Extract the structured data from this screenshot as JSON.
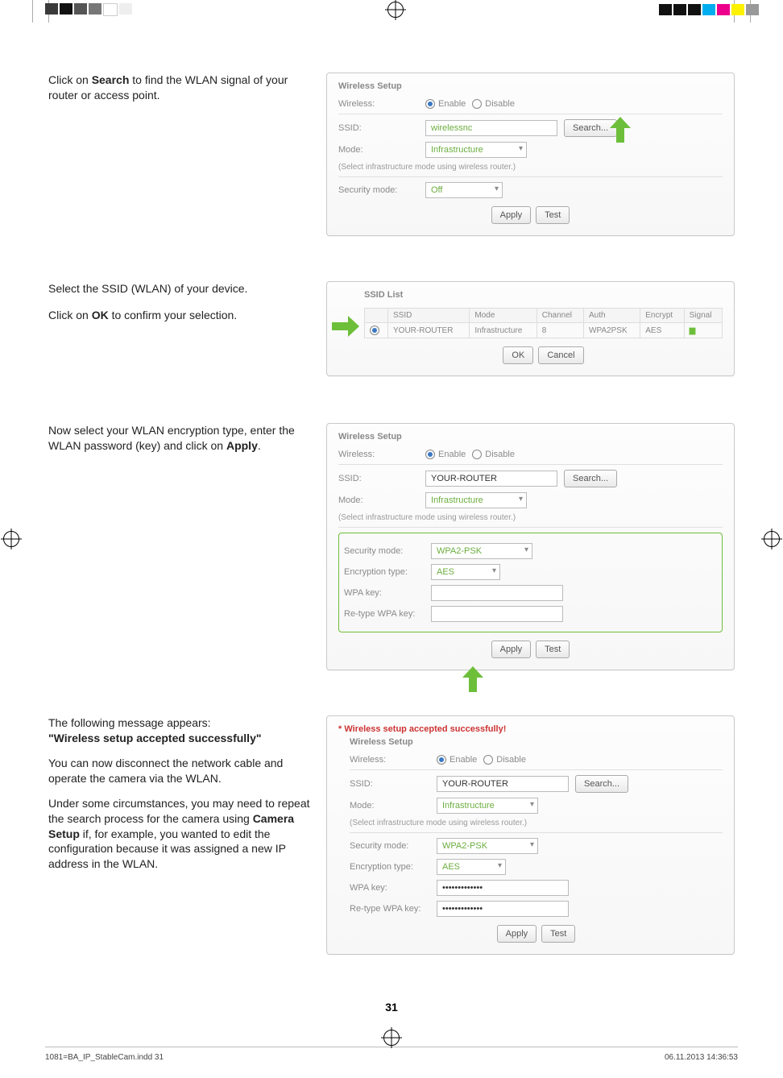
{
  "page_number": "31",
  "footer": {
    "file": "1081=BA_IP_StableCam.indd   31",
    "date": "06.11.2013   14:36:53"
  },
  "step1": {
    "text_pre": "Click on ",
    "bold1": "Search",
    "text_post": " to find the WLAN signal of your router or access point.",
    "panel_title": "Wireless Setup",
    "wireless_label": "Wireless:",
    "enable": "Enable",
    "disable": "Disable",
    "ssid_label": "SSID:",
    "ssid_value": "wirelessnc",
    "search_btn": "Search...",
    "mode_label": "Mode:",
    "mode_value": "Infrastructure",
    "mode_hint": "(Select infrastructure mode using wireless router.)",
    "sec_label": "Security mode:",
    "sec_value": "Off",
    "apply_btn": "Apply",
    "test_btn": "Test"
  },
  "step2": {
    "line1": "Select the SSID (WLAN) of your device.",
    "line2_pre": "Click on ",
    "line2_bold": "OK",
    "line2_post": " to confirm your selection.",
    "panel_title": "SSID List",
    "th_ssid": "SSID",
    "th_mode": "Mode",
    "th_channel": "Channel",
    "th_auth": "Auth",
    "th_encrypt": "Encrypt",
    "th_signal": "Signal",
    "row_ssid": "YOUR-ROUTER",
    "row_mode": "Infrastructure",
    "row_channel": "8",
    "row_auth": "WPA2PSK",
    "row_encrypt": "AES",
    "ok_btn": "OK",
    "cancel_btn": "Cancel"
  },
  "step3": {
    "text_pre": "Now select your WLAN encryption type, enter the WLAN password (key) and click on ",
    "bold": "Apply",
    "text_post": ".",
    "panel_title": "Wireless Setup",
    "wireless_label": "Wireless:",
    "enable": "Enable",
    "disable": "Disable",
    "ssid_label": "SSID:",
    "ssid_value": "YOUR-ROUTER",
    "search_btn": "Search...",
    "mode_label": "Mode:",
    "mode_value": "Infrastructure",
    "mode_hint": "(Select infrastructure mode using wireless router.)",
    "sec_label": "Security mode:",
    "sec_value": "WPA2-PSK",
    "enc_label": "Encryption type:",
    "enc_value": "AES",
    "wpa_label": "WPA key:",
    "rewpa_label": "Re-type WPA key:",
    "apply_btn": "Apply",
    "test_btn": "Test"
  },
  "step4": {
    "para1_pre": "The following message appears:",
    "para1_bold": "\"Wireless setup accepted successfully\"",
    "para2": "You can now disconnect the network cable and operate the camera via the WLAN.",
    "para3_pre": "Under some circumstances, you may need to repeat the search process for the camera using ",
    "para3_bold1": "Camera",
    "para3_bold2": "Setup",
    "para3_post": " if, for example, you wanted to edit the configuration because it was assigned a new IP address in the WLAN.",
    "success": "* Wireless setup accepted successfully!",
    "panel_title": "Wireless Setup",
    "wireless_label": "Wireless:",
    "enable": "Enable",
    "disable": "Disable",
    "ssid_label": "SSID:",
    "ssid_value": "YOUR-ROUTER",
    "search_btn": "Search...",
    "mode_label": "Mode:",
    "mode_value": "Infrastructure",
    "mode_hint": "(Select infrastructure mode using wireless router.)",
    "sec_label": "Security mode:",
    "sec_value": "WPA2-PSK",
    "enc_label": "Encryption type:",
    "enc_value": "AES",
    "wpa_label": "WPA key:",
    "wpa_val": "•••••••••••••",
    "rewpa_label": "Re-type WPA key:",
    "rewpa_val": "•••••••••••••",
    "apply_btn": "Apply",
    "test_btn": "Test"
  }
}
